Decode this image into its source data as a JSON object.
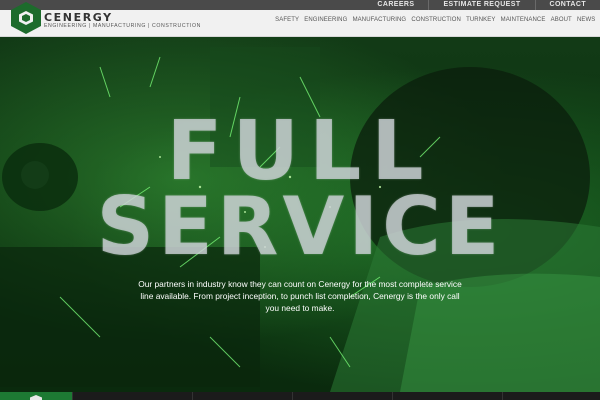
{
  "utility_nav": [
    "CAREERS",
    "ESTIMATE REQUEST",
    "CONTACT"
  ],
  "brand": {
    "name": "CENERGY",
    "tagline": "ENGINEERING  |  MANUFACTURING  |  CONSTRUCTION",
    "accent_color": "#1d6b2c"
  },
  "main_nav": [
    "SAFETY",
    "ENGINEERING",
    "MANUFACTURING",
    "CONSTRUCTION",
    "TURNKEY",
    "MAINTENANCE",
    "ABOUT",
    "NEWS"
  ],
  "hero": {
    "title_line1": "FULL",
    "title_line2": "SERVICE",
    "text": "Our partners in industry know they can count on Cenergy for the most complete service line available. From project inception, to punch list completion, Cenergy is the only call you need to make.",
    "background": "welder-with-sparks-green-tint"
  },
  "icons": {
    "logo": "hexagon-logo-icon",
    "footer_logo": "hexagon-icon"
  }
}
